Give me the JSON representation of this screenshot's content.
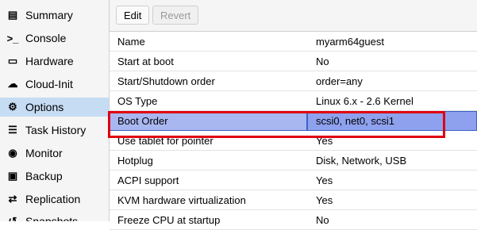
{
  "sidebar": {
    "items": [
      {
        "label": "Summary",
        "icon": "book-icon",
        "glyph": "▤"
      },
      {
        "label": "Console",
        "icon": "terminal-icon",
        "glyph": ">_"
      },
      {
        "label": "Hardware",
        "icon": "monitor-icon",
        "glyph": "▭"
      },
      {
        "label": "Cloud-Init",
        "icon": "cloud-icon",
        "glyph": "☁"
      },
      {
        "label": "Options",
        "icon": "gear-icon",
        "glyph": "⚙"
      },
      {
        "label": "Task History",
        "icon": "list-icon",
        "glyph": "☰"
      },
      {
        "label": "Monitor",
        "icon": "eye-icon",
        "glyph": "◉"
      },
      {
        "label": "Backup",
        "icon": "floppy-icon",
        "glyph": "▣"
      },
      {
        "label": "Replication",
        "icon": "retweet-icon",
        "glyph": "⇄"
      },
      {
        "label": "Snapshots",
        "icon": "history-icon",
        "glyph": "↺"
      }
    ],
    "selected": "Options"
  },
  "toolbar": {
    "edit_label": "Edit",
    "revert_label": "Revert"
  },
  "options": {
    "rows": [
      {
        "name": "Name",
        "value": "myarm64guest"
      },
      {
        "name": "Start at boot",
        "value": "No"
      },
      {
        "name": "Start/Shutdown order",
        "value": "order=any"
      },
      {
        "name": "OS Type",
        "value": "Linux 6.x - 2.6 Kernel"
      },
      {
        "name": "Boot Order",
        "value": "scsi0, net0, scsi1"
      },
      {
        "name": "Use tablet for pointer",
        "value": "Yes"
      },
      {
        "name": "Hotplug",
        "value": "Disk, Network, USB"
      },
      {
        "name": "ACPI support",
        "value": "Yes"
      },
      {
        "name": "KVM hardware virtualization",
        "value": "Yes"
      },
      {
        "name": "Freeze CPU at startup",
        "value": "No"
      }
    ],
    "selected_row": "Boot Order"
  },
  "colors": {
    "selection": "#8ea1ee",
    "sidebar_selected": "#c5dcf3",
    "annotation_outline": "#e00010"
  }
}
